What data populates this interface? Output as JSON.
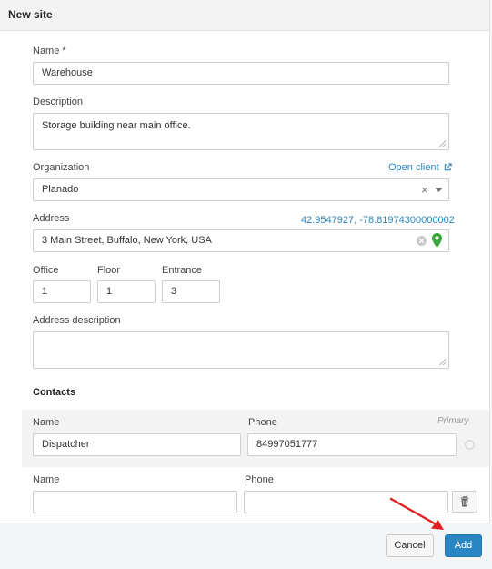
{
  "dialog": {
    "title": "New site"
  },
  "fields": {
    "name": {
      "label": "Name *",
      "value": "Warehouse"
    },
    "description": {
      "label": "Description",
      "value": "Storage building near main office."
    },
    "organization": {
      "label": "Organization",
      "value": "Planado",
      "link": "Open client",
      "clear_glyph": "×"
    },
    "address": {
      "label": "Address",
      "coords": "42.9547927, -78.81974300000002",
      "value": "3 Main Street, Buffalo, New York, USA"
    },
    "office": {
      "label": "Office",
      "value": "1"
    },
    "floor": {
      "label": "Floor",
      "value": "1"
    },
    "entrance": {
      "label": "Entrance",
      "value": "3"
    },
    "address_description": {
      "label": "Address description",
      "value": ""
    }
  },
  "contacts": {
    "title": "Contacts",
    "primary_tag": "Primary",
    "rows": [
      {
        "name_label": "Name",
        "phone_label": "Phone",
        "name": "Dispatcher",
        "phone": "84997051777"
      },
      {
        "name_label": "Name",
        "phone_label": "Phone",
        "name": "",
        "phone": ""
      }
    ]
  },
  "footer": {
    "cancel_label": "Cancel",
    "add_label": "Add"
  },
  "colors": {
    "accent": "#2a86c2",
    "map_pin": "#3aa83a",
    "annotation_arrow": "#e02020"
  },
  "icons": {
    "external_link": "external-link-icon",
    "dropdown": "chevron-down-icon",
    "clear": "clear-icon",
    "map_pin": "map-pin-icon",
    "trash": "trash-icon",
    "radio": "radio-icon"
  }
}
